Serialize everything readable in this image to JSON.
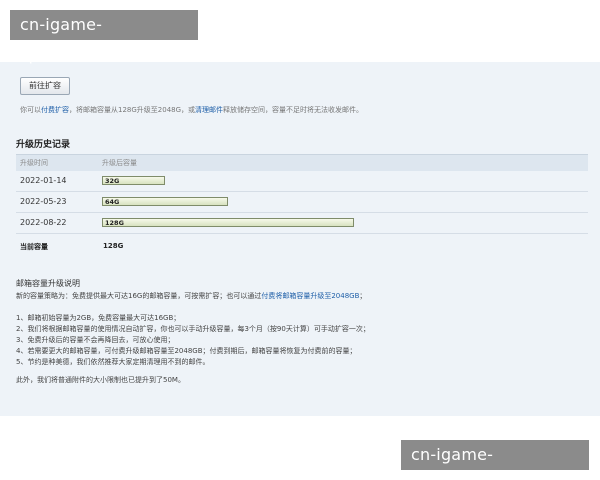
{
  "watermark": {
    "top_text": "cn-igame-sports.com",
    "bottom_text": "cn-igame-sports.com"
  },
  "toolbar": {
    "expand_label": "前往扩容"
  },
  "intro": {
    "prefix": "你可以",
    "pay_link": "付费扩容",
    "middle": "，将邮箱容量从128G升级至2048G，或",
    "clean_link": "清理邮件",
    "suffix": "释放储存空间，容量不足时将无法收发邮件。"
  },
  "history": {
    "title": "升级历史记录",
    "col_time": "升级时间",
    "col_capacity": "升级后容量",
    "rows": [
      {
        "date": "2022-01-14",
        "capacity": "32G",
        "capacity_gb": 32
      },
      {
        "date": "2022-05-23",
        "capacity": "64G",
        "capacity_gb": 64
      },
      {
        "date": "2022-08-22",
        "capacity": "128G",
        "capacity_gb": 128
      }
    ],
    "current_label": "当前容量",
    "current_value": "128G"
  },
  "notes": {
    "title": "邮箱容量升级说明",
    "strategy_prefix": "新的容量策略为：免费提供最大可达16G的邮箱容量，可按需扩容；也可以通过",
    "strategy_link": "付费将邮箱容量升级至2048GB",
    "strategy_suffix": "；",
    "items": [
      "1、邮箱初始容量为2GB，免费容量最大可达16GB；",
      "2、我们将根据邮箱容量的使用情况自动扩容，你也可以手动升级容量，每3个月（按90天计算）可手动扩容一次；",
      "3、免费升级后的容量不会再降回去，可放心使用；",
      "4、若需要更大的邮箱容量，可付费升级邮箱容量至2048GB；付费到期后，邮箱容量将恢复为付费前的容量；",
      "5、节约是种美德，我们依然推荐大家定期清理用不到的邮件。"
    ],
    "footer": "此外，我们将普通附件的大小限制也已提升到了50M。"
  }
}
